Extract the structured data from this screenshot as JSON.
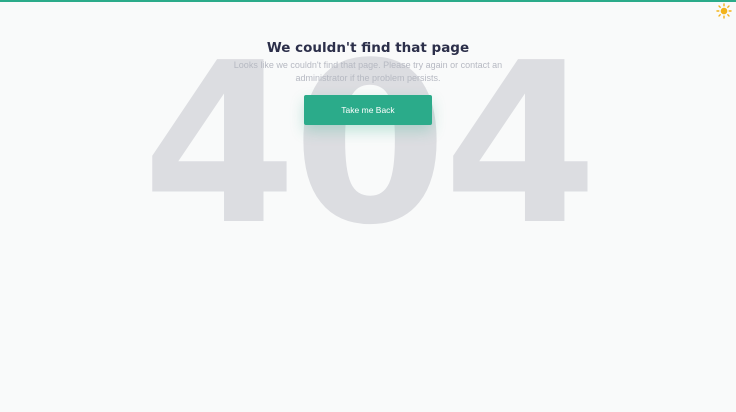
{
  "background_code": "404",
  "heading": "We couldn't find that page",
  "message": "Looks like we couldn't find that page. Please try again or contact an administrator if the problem persists.",
  "back_button_label": "Take me Back",
  "theme_toggle_icon": "sun-icon",
  "colors": {
    "accent": "#2bab8a",
    "heading": "#2c2f4a",
    "message": "#b6b9c2",
    "background_code": "#dcdde1",
    "page_background": "#f9fafa",
    "sun_icon": "#f2b31b"
  }
}
